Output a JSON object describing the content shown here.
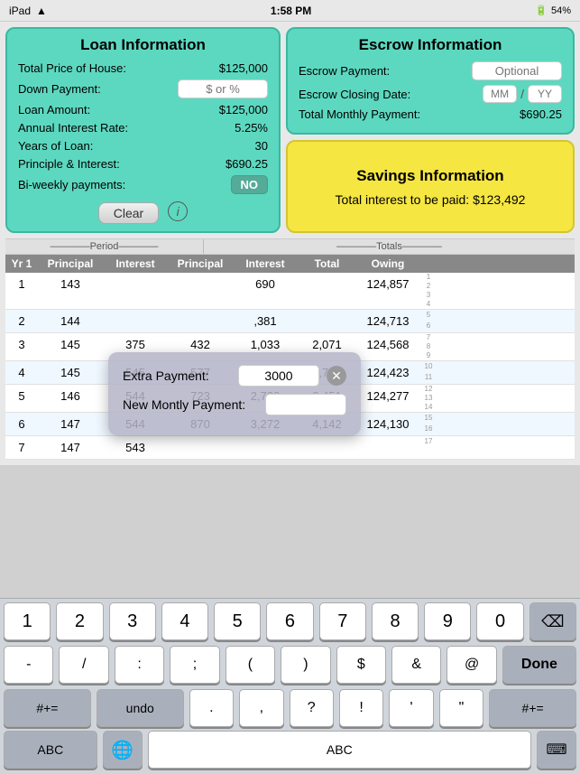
{
  "statusBar": {
    "left": "iPad",
    "time": "1:58 PM",
    "battery": "54%"
  },
  "loanPanel": {
    "title": "Loan Information",
    "rows": [
      {
        "label": "Total Price of House:",
        "value": "$125,000",
        "type": "value"
      },
      {
        "label": "Down Payment:",
        "placeholder": "$ or %",
        "type": "input"
      },
      {
        "label": "Loan Amount:",
        "value": "$125,000",
        "type": "value"
      },
      {
        "label": "Annual Interest Rate:",
        "value": "5.25%",
        "type": "value"
      },
      {
        "label": "Years of Loan:",
        "value": "30",
        "type": "value"
      },
      {
        "label": "Principle & Interest:",
        "value": "$690.25",
        "type": "value"
      },
      {
        "label": "Bi-weekly payments:",
        "value": "NO",
        "type": "toggle"
      }
    ],
    "clearLabel": "Clear"
  },
  "escrowPanel": {
    "title": "Escrow Information",
    "rows": [
      {
        "label": "Escrow Payment:",
        "placeholder": "Optional"
      },
      {
        "label": "Escrow Closing Date:",
        "mm": "MM",
        "yy": "YY"
      },
      {
        "label": "Total Monthly Payment:",
        "value": "$690.25"
      }
    ]
  },
  "savingsPanel": {
    "title": "Savings Information",
    "text": "Total interest to be paid: $123,492"
  },
  "tableSection": {
    "periodLabel": "Period",
    "totalsLabel": "Totals",
    "columns": [
      "Yr 1",
      "Principal",
      "Interest",
      "Principal",
      "Interest",
      "Total",
      "Owing"
    ],
    "rows": [
      {
        "yr": "1",
        "p1": "143",
        "i1": "",
        "p2": "",
        "i2": "690",
        "total": "",
        "owing": "124,857",
        "lines": [
          "1",
          "2",
          "3",
          "4"
        ]
      },
      {
        "yr": "2",
        "p1": "144",
        "i1": "",
        "p2": "",
        "i2": ",381",
        "total": "",
        "owing": "124,713",
        "lines": [
          "5",
          "6"
        ]
      },
      {
        "yr": "3",
        "p1": "145",
        "i1": "375",
        "p2": "432",
        "i2": "1,033",
        "total": "2,071",
        "owing": "124,568",
        "lines": [
          "7",
          "8",
          "9"
        ]
      },
      {
        "yr": "4",
        "p1": "145",
        "i1": "545",
        "p2": "577",
        "i2": "2,184",
        "total": "2,761",
        "owing": "124,423",
        "lines": [
          "10",
          "11"
        ]
      },
      {
        "yr": "5",
        "p1": "146",
        "i1": "544",
        "p2": "723",
        "i2": "2,728",
        "total": "3,451",
        "owing": "124,277",
        "lines": [
          "12",
          "13",
          "14"
        ]
      },
      {
        "yr": "6",
        "p1": "147",
        "i1": "544",
        "p2": "870",
        "i2": "3,272",
        "total": "4,142",
        "owing": "124,130",
        "lines": [
          "15",
          "16"
        ]
      }
    ]
  },
  "popup": {
    "extraPaymentLabel": "Extra Payment:",
    "extraPaymentValue": "3000",
    "newMonthlyLabel": "New Montly Payment:",
    "newMonthlyValue": ""
  },
  "keyboard": {
    "row1": [
      "1",
      "2",
      "3",
      "4",
      "5",
      "6",
      "7",
      "8",
      "9",
      "0",
      "⌫"
    ],
    "row2": [
      "-",
      "/",
      ":",
      ";",
      "(",
      ")",
      "$",
      "&",
      "@",
      "Done"
    ],
    "row3": [
      "#+=",
      "undo",
      ".",
      ",",
      "?",
      "!",
      "'",
      "\"",
      "#+="
    ],
    "row4_left": "ABC",
    "row4_space": "ABC",
    "row4_globe": "🌐"
  }
}
